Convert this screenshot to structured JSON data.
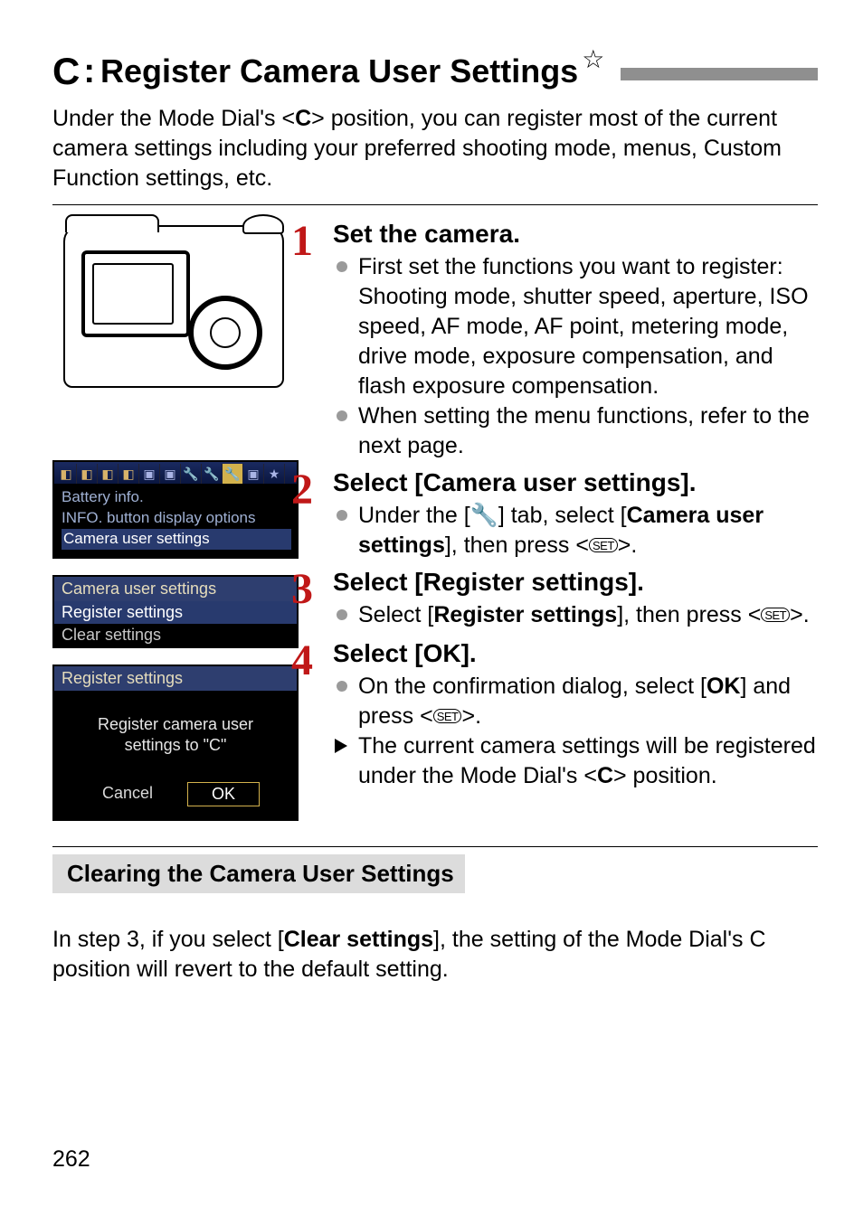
{
  "title": {
    "c_glyph": "C",
    "text": "Register Camera User Settings",
    "star": "☆"
  },
  "intro": {
    "pre": "Under the Mode Dial's <",
    "c_glyph": "C",
    "post": "> position, you can register most of the current camera settings including your preferred shooting mode, menus, Custom Function settings, etc."
  },
  "menu1": {
    "items": [
      "Battery info.",
      "INFO. button display options",
      "Camera user settings"
    ]
  },
  "menu2": {
    "title": "Camera user settings",
    "rows": [
      "Register settings",
      "Clear settings"
    ]
  },
  "dialog": {
    "title": "Register settings",
    "msg1": "Register camera user",
    "msg2": "settings to \"C\"",
    "cancel": "Cancel",
    "ok": "OK"
  },
  "steps": {
    "s1": {
      "num": "1",
      "head": "Set the camera.",
      "b1": "First set the functions you want to register: Shooting mode, shutter speed, aperture, ISO speed, AF mode, AF point, metering mode, drive mode, exposure compensation, and flash exposure compensation.",
      "b2": "When setting the menu functions, refer to the next page."
    },
    "s2": {
      "num": "2",
      "head": "Select [Camera user settings].",
      "b1_pre": "Under the [",
      "b1_icon": "🔧",
      "b1_tab": "] tab, select [",
      "b1_bold": "Camera user settings",
      "b1_mid": "], then press <",
      "b1_set": "SET",
      "b1_post": ">."
    },
    "s3": {
      "num": "3",
      "head": "Select [Register settings].",
      "b1_pre": "Select [",
      "b1_bold": "Register settings",
      "b1_mid": "], then press <",
      "b1_set": "SET",
      "b1_post": ">."
    },
    "s4": {
      "num": "4",
      "head": "Select [OK].",
      "b1_pre": "On the confirmation dialog, select [",
      "b1_bold": "OK",
      "b1_mid": "] and press <",
      "b1_set": "SET",
      "b1_post": ">.",
      "b2_pre": "The current camera settings will be registered under the Mode Dial's <",
      "b2_c": "C",
      "b2_post": "> position."
    }
  },
  "clearing": {
    "head": "Clearing the Camera User Settings",
    "body_pre": "In step 3, if you select [",
    "body_bold": "Clear settings",
    "body_post": "], the setting of the Mode Dial's C position will revert to the default setting."
  },
  "page": "262"
}
